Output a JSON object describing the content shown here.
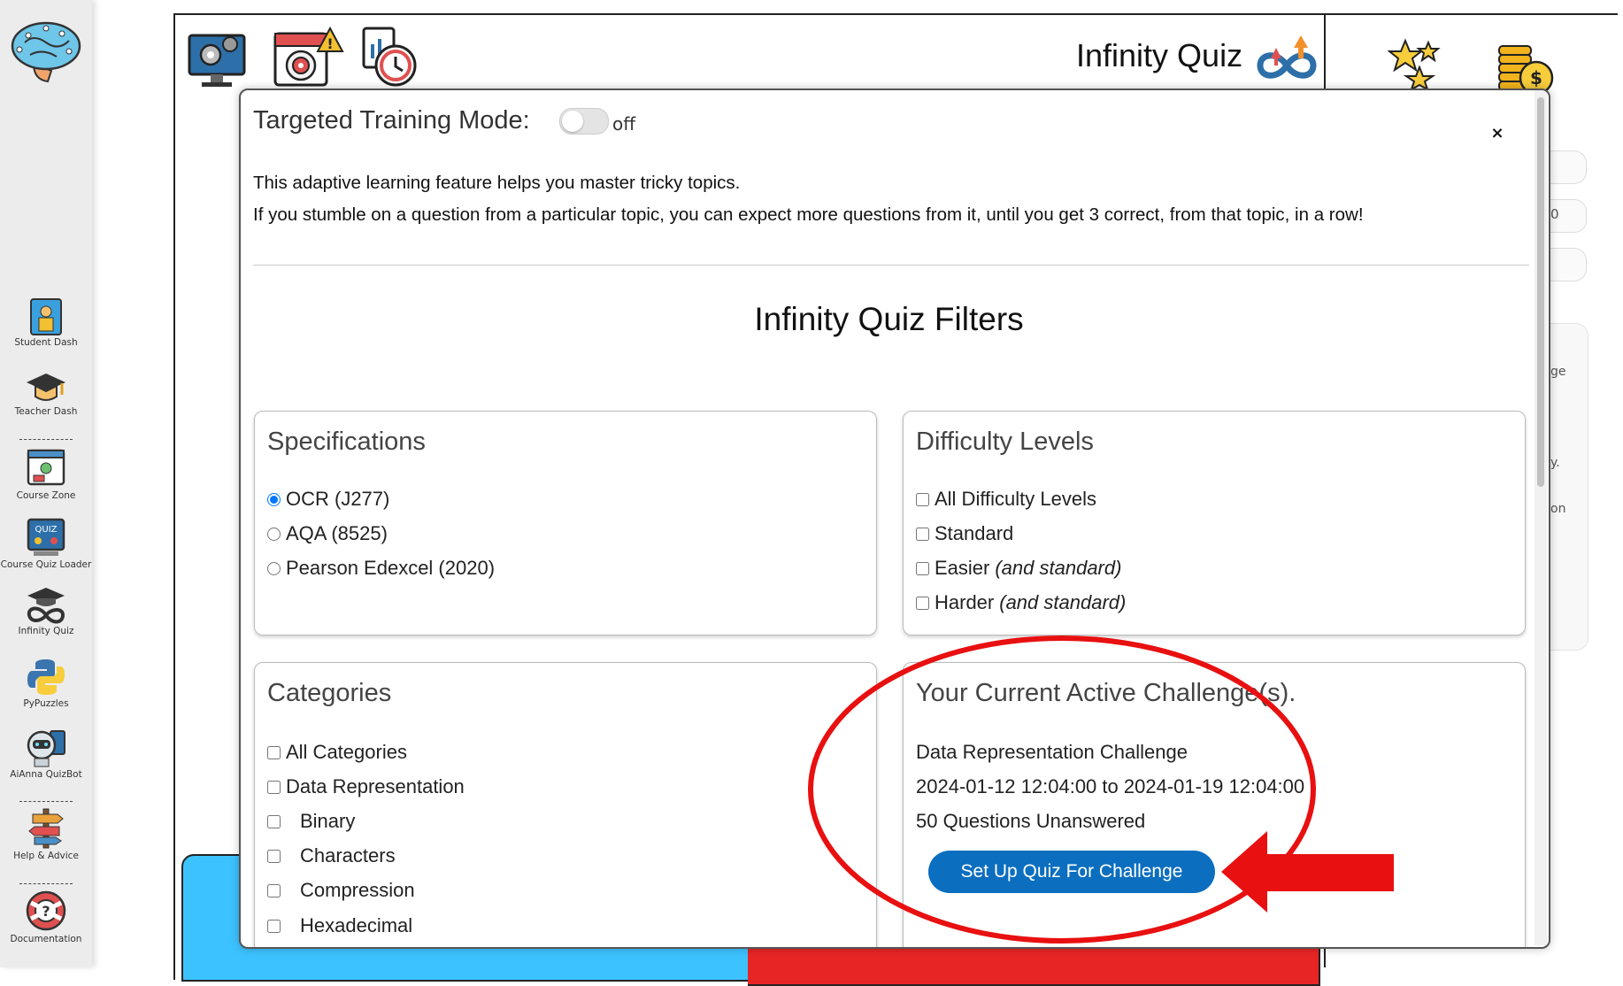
{
  "sidebar": {
    "items": [
      {
        "label": "Student Dash",
        "icon": "student-dash-icon"
      },
      {
        "label": "Teacher Dash",
        "icon": "graduation-cap-icon"
      },
      {
        "label": "Course Zone",
        "icon": "course-zone-icon"
      },
      {
        "label": "Course Quiz Loader",
        "icon": "quiz-loader-icon"
      },
      {
        "label": "Infinity Quiz",
        "icon": "infinity-quiz-icon"
      },
      {
        "label": "PyPuzzles",
        "icon": "python-icon"
      },
      {
        "label": "AiAnna QuizBot",
        "icon": "robot-icon"
      },
      {
        "label": "Help & Advice",
        "icon": "signpost-icon"
      },
      {
        "label": "Documentation",
        "icon": "lifebuoy-icon"
      }
    ]
  },
  "header": {
    "title": "Infinity Quiz"
  },
  "background_fragments": [
    "0",
    "ge",
    "y.",
    "on"
  ],
  "modal": {
    "training_label": "Targeted Training Mode:",
    "training_state": "off",
    "close_label": "×",
    "intro_line1": "This adaptive learning feature helps you master tricky topics.",
    "intro_line2": "If you stumble on a question from a particular topic, you can expect more questions from it, until you get 3 correct, from that topic, in a row!",
    "filters_title": "Infinity Quiz Filters",
    "specifications": {
      "title": "Specifications",
      "options": [
        "OCR (J277)",
        "AQA (8525)",
        "Pearson Edexcel (2020)"
      ],
      "selected": "OCR (J277)"
    },
    "difficulty": {
      "title": "Difficulty Levels",
      "options": [
        {
          "label": "All Difficulty Levels",
          "note": ""
        },
        {
          "label": "Standard",
          "note": ""
        },
        {
          "label": "Easier",
          "note": "(and standard)"
        },
        {
          "label": "Harder",
          "note": "(and standard)"
        }
      ]
    },
    "categories": {
      "title": "Categories",
      "options": [
        "All Categories",
        "Data Representation"
      ],
      "sub_options": [
        "Binary",
        "Characters",
        "Compression",
        "Hexadecimal"
      ]
    },
    "challenges": {
      "title": "Your Current Active Challenge(s).",
      "name": "Data Representation Challenge",
      "period": "2024-01-12 12:04:00 to 2024-01-19 12:04:00",
      "unanswered": "50 Questions Unanswered",
      "button_label": "Set Up Quiz For Challenge"
    }
  },
  "colors": {
    "accent_button": "#0b6ebf",
    "annotation": "#e81010",
    "bg_blue_tile": "#3cc3ff",
    "bg_red_tile": "#e82525"
  }
}
